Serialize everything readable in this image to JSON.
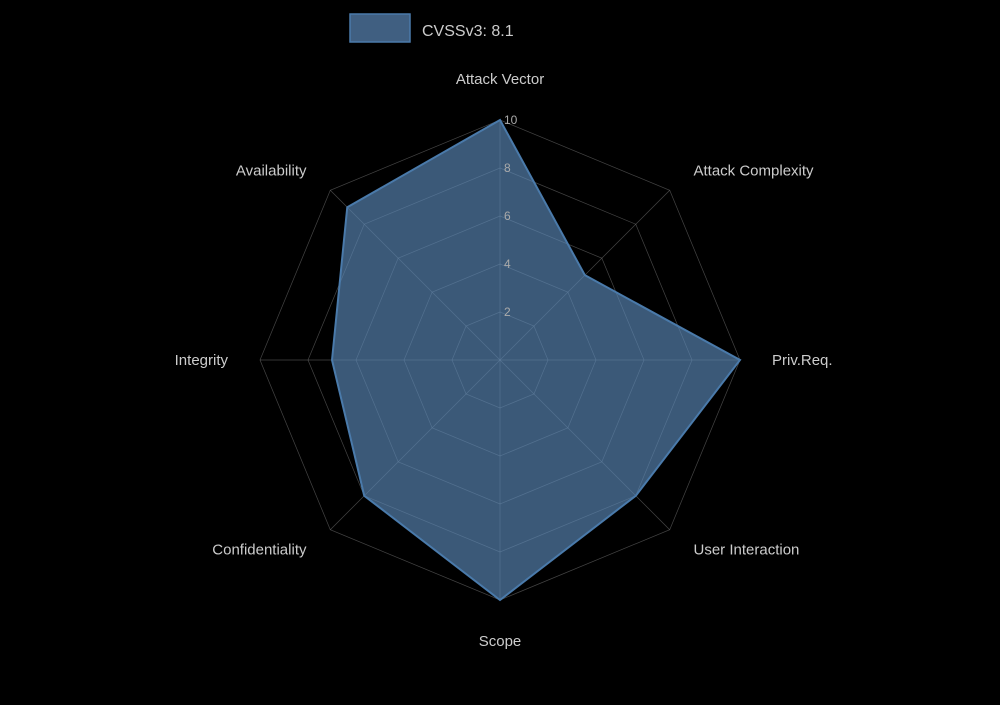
{
  "chart": {
    "title": "CVSSv3: 8.1",
    "color": "#5b88b8",
    "colorLight": "rgba(91,136,184,0.65)",
    "axes": [
      {
        "label": "Attack Vector",
        "value": 10,
        "angle": -90
      },
      {
        "label": "Attack Complexity",
        "value": 5,
        "angle": -38.57
      },
      {
        "label": "Priv.Req.",
        "value": 10,
        "angle": 12.86
      },
      {
        "label": "User Interaction",
        "value": 8,
        "angle": 64.29
      },
      {
        "label": "Scope",
        "value": 10,
        "angle": 115.71
      },
      {
        "label": "Confidentiality",
        "value": 8,
        "angle": 167.14
      },
      {
        "label": "Integrity",
        "value": 7,
        "angle": 218.57
      },
      {
        "label": "Availability",
        "value": 9,
        "angle": 270
      }
    ],
    "gridLevels": [
      2,
      4,
      6,
      8,
      10
    ],
    "maxValue": 10
  }
}
